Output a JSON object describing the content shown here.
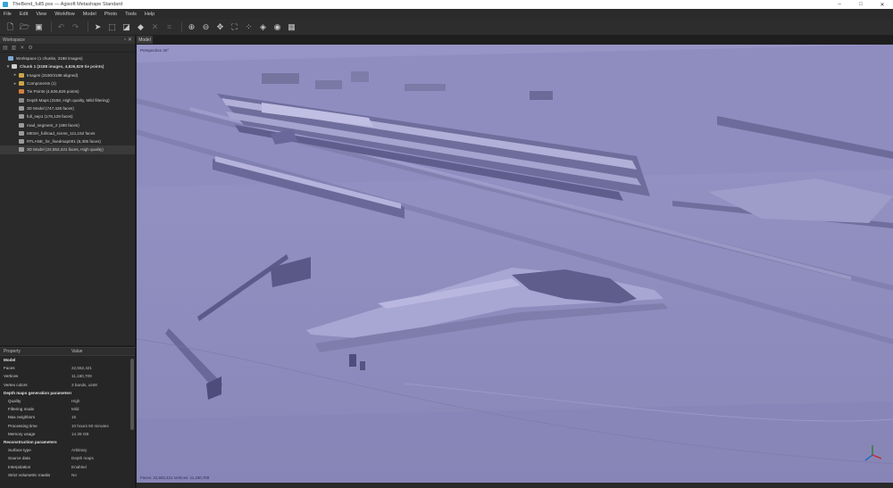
{
  "window": {
    "title": "TheBend_full5.psx — Agisoft Metashape Standard",
    "controls": [
      "–",
      "□",
      "✕"
    ]
  },
  "menu": [
    "File",
    "Edit",
    "View",
    "Workflow",
    "Model",
    "Photo",
    "Tools",
    "Help"
  ],
  "workspace": {
    "panel_title": "Workspace",
    "items": [
      {
        "label": "Workspace (1 chunks, 3188 images)",
        "icon_color": "#7fa7d6",
        "twisty": "",
        "bold": false
      },
      {
        "label": "Chunk 1 (3188 images, 4,826,829 tie points)",
        "icon_color": "#cfcfcf",
        "twisty": "▾",
        "bold": true
      },
      {
        "label": "Images (3180/3188 aligned)",
        "icon_color": "#c9a54a",
        "twisty": "▸",
        "bold": false
      },
      {
        "label": "Components (1)",
        "icon_color": "#c9a54a",
        "twisty": "▸",
        "bold": false
      },
      {
        "label": "Tie Points (4,826,829 points)",
        "icon_color": "#d67f3a",
        "twisty": "",
        "bold": false
      },
      {
        "label": "Depth Maps (3158, High quality, Mild filtering)",
        "icon_color": "#8a8a8a",
        "twisty": "",
        "bold": false
      },
      {
        "label": "3D Model (747,426 faces)",
        "icon_color": "#9a9a9a",
        "twisty": "",
        "bold": false
      },
      {
        "label": "full_sep1 (178,129 faces)",
        "icon_color": "#9a9a9a",
        "twisty": "",
        "bold": false
      },
      {
        "label": "road_segment_2 (480 faces)",
        "icon_color": "#9a9a9a",
        "twisty": "",
        "bold": false
      },
      {
        "label": "MESH_fullroad_scene_111,152 faces",
        "icon_color": "#9a9a9a",
        "twisty": "",
        "bold": false
      },
      {
        "label": "RTLANE_for_fixedmap001 (8,305 faces)",
        "icon_color": "#9a9a9a",
        "twisty": "",
        "bold": false
      },
      {
        "label": "3D Model (22,552,421 faces, High quality)",
        "icon_color": "#9a9a9a",
        "twisty": "",
        "bold": false,
        "selected": true
      }
    ]
  },
  "properties": {
    "col_property": "Property",
    "col_value": "Value",
    "rows": [
      {
        "key": "Model",
        "value": "",
        "section": true
      },
      {
        "key": "Faces",
        "value": "22,552,421"
      },
      {
        "key": "Vertices",
        "value": "11,180,709"
      },
      {
        "key": "Vertex colors",
        "value": "3 bands, uint8"
      },
      {
        "key": "Depth maps generation parameters",
        "value": "",
        "section": true
      },
      {
        "key": "Quality",
        "value": "High",
        "indent": true
      },
      {
        "key": "Filtering mode",
        "value": "Mild",
        "indent": true
      },
      {
        "key": "Max neighbors",
        "value": "16",
        "indent": true
      },
      {
        "key": "Processing time",
        "value": "10 hours 50 minutes",
        "indent": true
      },
      {
        "key": "Memory usage",
        "value": "14.39 GB",
        "indent": true
      },
      {
        "key": "Reconstruction parameters",
        "value": "",
        "section": true
      },
      {
        "key": "Surface type",
        "value": "Arbitrary",
        "indent": true
      },
      {
        "key": "Source data",
        "value": "Depth maps",
        "indent": true
      },
      {
        "key": "Interpolation",
        "value": "Enabled",
        "indent": true
      },
      {
        "key": "Strict volumetric masks",
        "value": "No",
        "indent": true
      }
    ]
  },
  "model_view": {
    "tab": "Model",
    "projection": "Perspective 30°",
    "status": "Faces: 22,552,421 Vertices: 11,180,709",
    "mesh_color": "#8e8cbe"
  }
}
